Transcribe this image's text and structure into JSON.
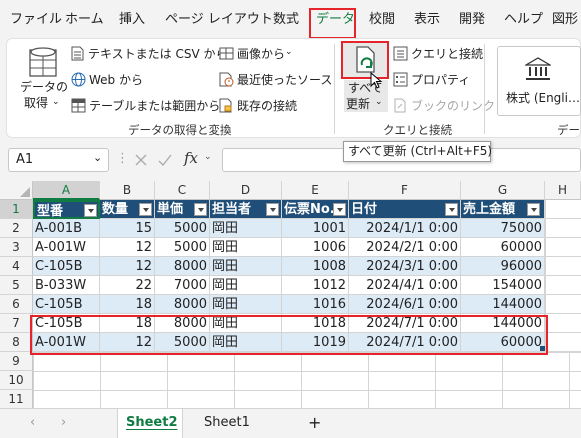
{
  "menu": {
    "items": [
      "ファイル",
      "ホーム",
      "挿入",
      "ページ レイアウト",
      "数式",
      "データ",
      "校閲",
      "表示",
      "開発",
      "ヘルプ",
      "図形"
    ],
    "active_index": 5
  },
  "ribbon": {
    "get_data": {
      "label_line1": "データの",
      "label_line2": "取得"
    },
    "text_csv": "テキストまたは CSV から",
    "web": "Web から",
    "table_range": "テーブルまたは範囲から",
    "from_picture": "画像から",
    "recent_sources": "最近使ったソース",
    "existing_connections": "既存の接続",
    "group_get_transform": "データの取得と変換",
    "refresh_all": {
      "label_line1": "すべて",
      "label_line2": "更新"
    },
    "queries_connections": "クエリと接続",
    "properties": "プロパティ",
    "workbook_links": "ブックのリンク",
    "group_queries": "クエリと接続",
    "stocks": "株式 (Engli…",
    "group_data_types": "データ"
  },
  "tooltip": "すべて更新 (Ctrl+Alt+F5)",
  "formula_bar": {
    "name_box": "A1",
    "fx": "fx",
    "value": ""
  },
  "sheet": {
    "columns": [
      "A",
      "B",
      "C",
      "D",
      "E",
      "F",
      "G",
      "H"
    ],
    "selected_column": "A",
    "selected_row": 1,
    "row_numbers": [
      "1",
      "2",
      "3",
      "4",
      "5",
      "6",
      "7",
      "8",
      "9",
      "10",
      "11"
    ],
    "headers": [
      "型番",
      "数量",
      "単価",
      "担当者",
      "伝票No.",
      "日付",
      "売上金額"
    ],
    "rows": [
      [
        "A-001B",
        "15",
        "5000",
        "岡田",
        "1001",
        "2024/1/1 0:00",
        "75000"
      ],
      [
        "A-001W",
        "12",
        "5000",
        "岡田",
        "1006",
        "2024/2/1 0:00",
        "60000"
      ],
      [
        "C-105B",
        "12",
        "8000",
        "岡田",
        "1008",
        "2024/3/1 0:00",
        "96000"
      ],
      [
        "B-033W",
        "22",
        "7000",
        "岡田",
        "1012",
        "2024/4/1 0:00",
        "154000"
      ],
      [
        "C-105B",
        "18",
        "8000",
        "岡田",
        "1016",
        "2024/6/1 0:00",
        "144000"
      ],
      [
        "C-105B",
        "18",
        "8000",
        "岡田",
        "1018",
        "2024/7/1 0:00",
        "144000"
      ],
      [
        "A-001W",
        "12",
        "5000",
        "岡田",
        "1019",
        "2024/7/1 0:00",
        "60000"
      ]
    ]
  },
  "tabs": {
    "items": [
      "Sheet2",
      "Sheet1"
    ],
    "active_index": 0,
    "add_label": "+"
  },
  "colors": {
    "accent": "#107c41",
    "highlight": "#e5252a",
    "table_header": "#1f4e78",
    "table_band": "#ddebf7"
  }
}
